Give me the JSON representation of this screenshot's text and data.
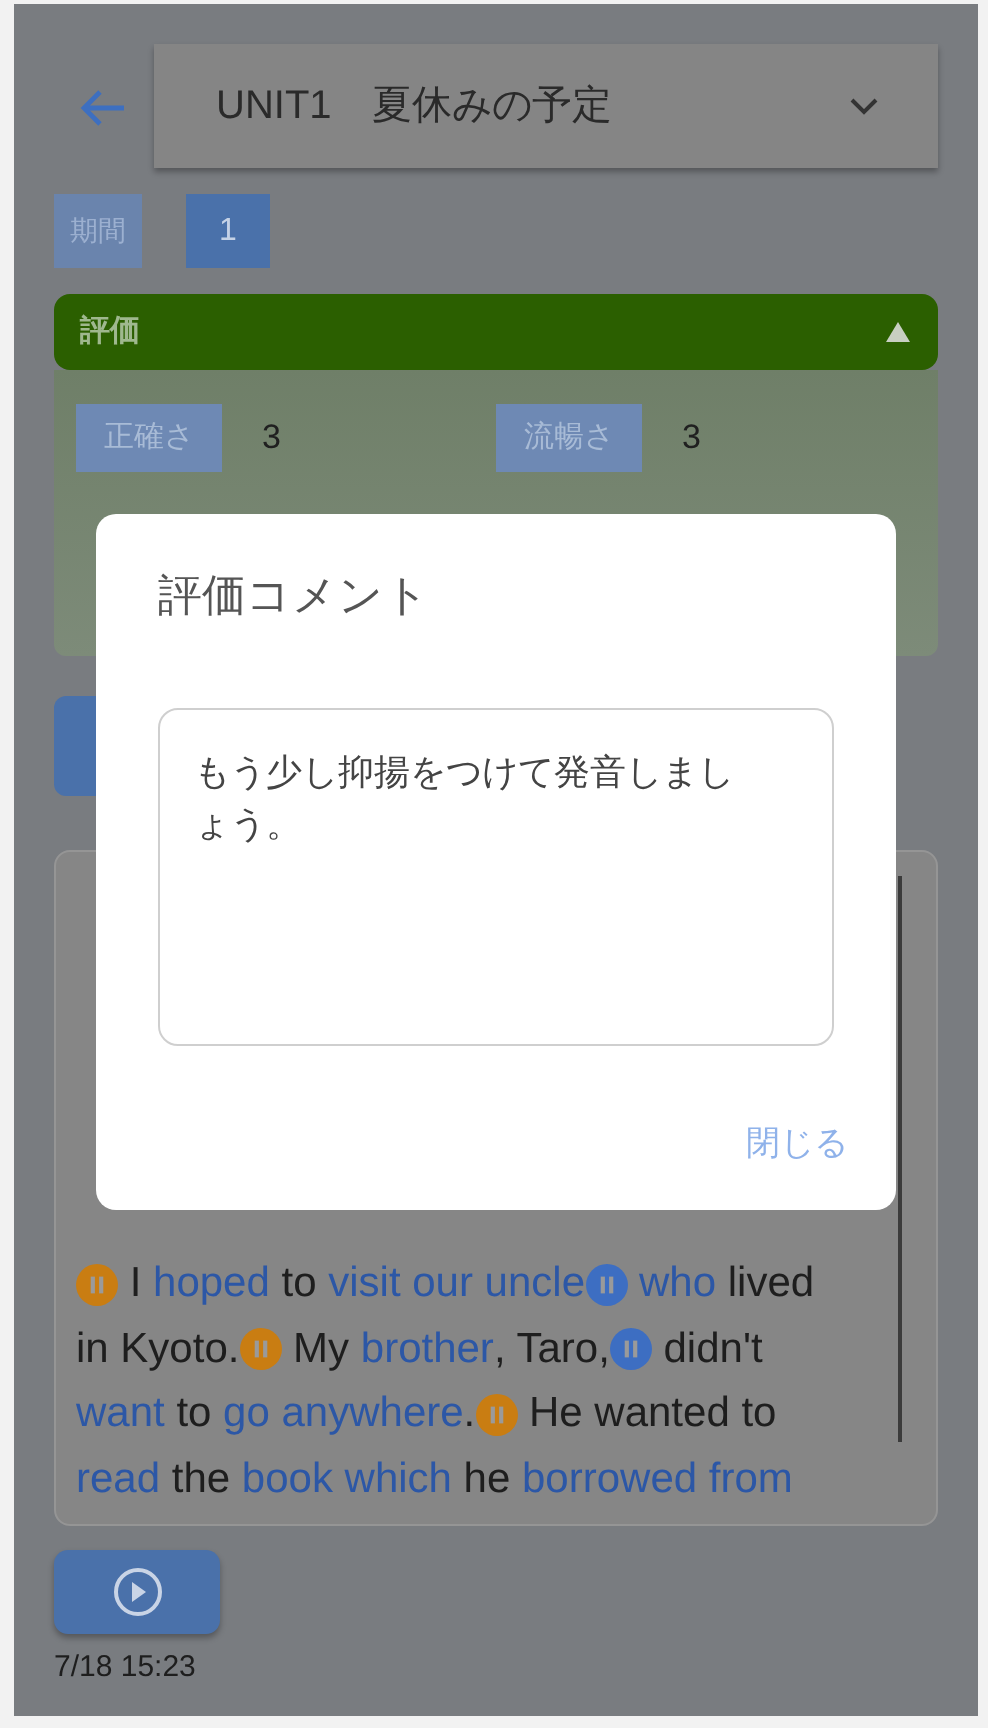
{
  "header": {
    "title": "UNIT1　夏休みの予定"
  },
  "period": {
    "label": "期間",
    "value": "1"
  },
  "evaluation": {
    "title": "評価",
    "expanded": true,
    "scores": [
      {
        "label": "正確さ",
        "value": "3"
      },
      {
        "label": "流暢さ",
        "value": "3"
      }
    ]
  },
  "passage": {
    "lines": [
      [
        {
          "kind": "pause",
          "color": "#c97d12"
        },
        {
          "kind": "text",
          "text": " I "
        },
        {
          "kind": "word",
          "text": "hoped"
        },
        {
          "kind": "text",
          "text": " to "
        },
        {
          "kind": "word",
          "text": "visit our uncle"
        },
        {
          "kind": "pause",
          "color": "#3d6ec2"
        },
        {
          "kind": "word",
          "text": "who"
        },
        {
          "kind": "text",
          "text": " lived"
        }
      ],
      [
        {
          "kind": "text",
          "text": "in Kyoto."
        },
        {
          "kind": "pause",
          "color": "#c97d12"
        },
        {
          "kind": "text",
          "text": " My "
        },
        {
          "kind": "word",
          "text": "brother"
        },
        {
          "kind": "text",
          "text": ", Taro,"
        },
        {
          "kind": "pause",
          "color": "#3d6ec2"
        },
        {
          "kind": "text",
          "text": " didn't"
        }
      ],
      [
        {
          "kind": "word",
          "text": "want"
        },
        {
          "kind": "text",
          "text": " to "
        },
        {
          "kind": "word",
          "text": "go anywhere"
        },
        {
          "kind": "text",
          "text": "."
        },
        {
          "kind": "pause",
          "color": "#c97d12"
        },
        {
          "kind": "text",
          "text": " He wanted to"
        }
      ],
      [
        {
          "kind": "word",
          "text": "read"
        },
        {
          "kind": "text",
          "text": " the "
        },
        {
          "kind": "word",
          "text": "book which"
        },
        {
          "kind": "text",
          "text": " he "
        },
        {
          "kind": "word",
          "text": "borrowed from"
        }
      ]
    ]
  },
  "recording": {
    "time": "7/18 15:23"
  },
  "dialog": {
    "title": "評価コメント",
    "comment": "もう少し抑揚をつけて発音しましょう。",
    "close": "閉じる"
  }
}
